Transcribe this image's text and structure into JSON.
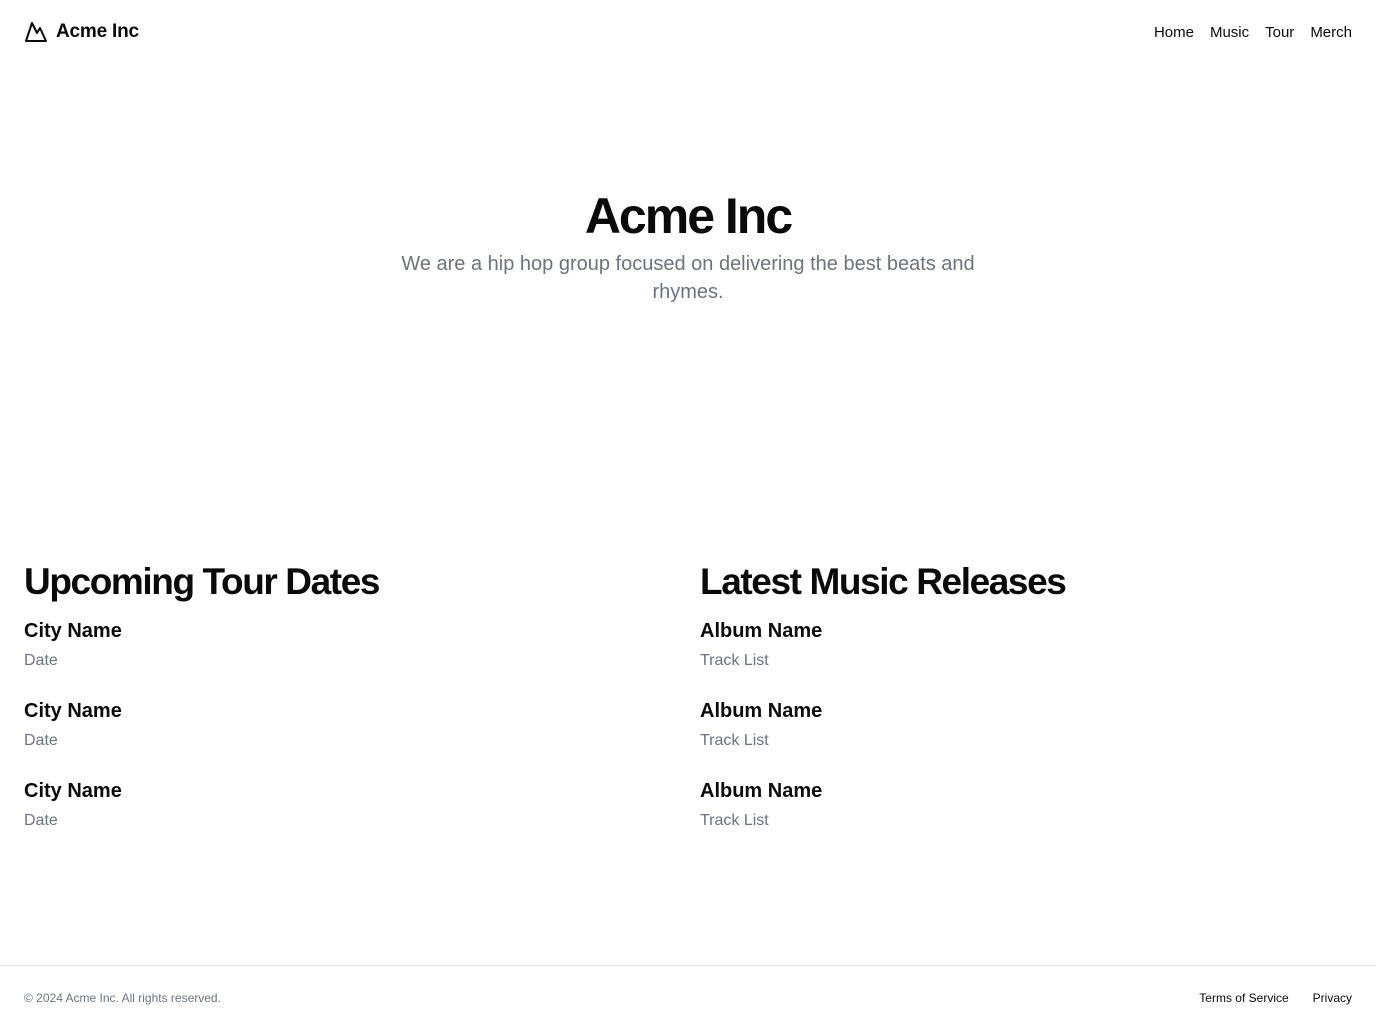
{
  "header": {
    "brand_name": "Acme Inc",
    "brand_icon": "mountain-icon",
    "nav": [
      {
        "label": "Home"
      },
      {
        "label": "Music"
      },
      {
        "label": "Tour"
      },
      {
        "label": "Merch"
      }
    ]
  },
  "hero": {
    "title": "Acme Inc",
    "subtitle": "We are a hip hop group focused on delivering the best beats and rhymes."
  },
  "tour": {
    "title": "Upcoming Tour Dates",
    "items": [
      {
        "title": "City Name",
        "subtitle": "Date"
      },
      {
        "title": "City Name",
        "subtitle": "Date"
      },
      {
        "title": "City Name",
        "subtitle": "Date"
      }
    ]
  },
  "music": {
    "title": "Latest Music Releases",
    "items": [
      {
        "title": "Album Name",
        "subtitle": "Track List"
      },
      {
        "title": "Album Name",
        "subtitle": "Track List"
      },
      {
        "title": "Album Name",
        "subtitle": "Track List"
      }
    ]
  },
  "footer": {
    "copyright": "© 2024 Acme Inc. All rights reserved.",
    "links": [
      {
        "label": "Terms of Service"
      },
      {
        "label": "Privacy"
      }
    ]
  },
  "colors": {
    "text": "#0a0a0a",
    "muted": "#6b7280",
    "border": "#e5e7eb"
  }
}
